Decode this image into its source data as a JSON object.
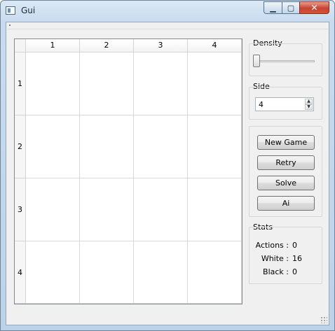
{
  "window": {
    "title": "Gui",
    "buttons": {
      "minimize": "▁",
      "maximize": "▢",
      "close": "✕"
    }
  },
  "board": {
    "columns": [
      "1",
      "2",
      "3",
      "4"
    ],
    "rows": [
      "1",
      "2",
      "3",
      "4"
    ]
  },
  "density": {
    "label": "Density",
    "value": 0
  },
  "side": {
    "label": "Side",
    "value": "4"
  },
  "actions": {
    "new_game": "New Game",
    "retry": "Retry",
    "solve": "Solve",
    "ai": "Ai"
  },
  "stats": {
    "title": "Stats",
    "actions_label": "Actions :",
    "actions_value": "0",
    "white_label": "White :",
    "white_value": "16",
    "black_label": "Black :",
    "black_value": "0"
  },
  "icons": {
    "app": "app-icon",
    "spin_up": "▲",
    "spin_down": "▼"
  }
}
